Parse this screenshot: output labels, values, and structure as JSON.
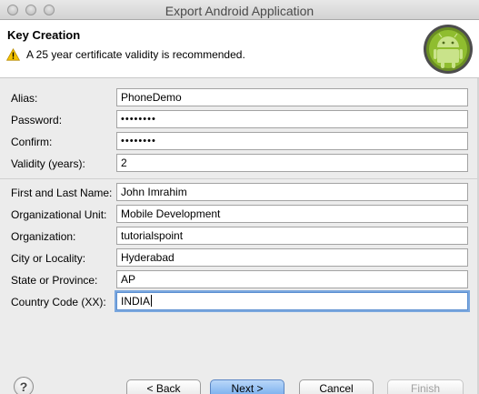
{
  "window": {
    "title": "Export Android Application"
  },
  "header": {
    "title": "Key Creation",
    "message": "A 25 year certificate validity is recommended."
  },
  "form": {
    "alias": {
      "label": "Alias:",
      "value": "PhoneDemo"
    },
    "password": {
      "label": "Password:",
      "value": "••••••••"
    },
    "confirm": {
      "label": "Confirm:",
      "value": "••••••••"
    },
    "validity": {
      "label": "Validity (years):",
      "value": "2"
    },
    "name": {
      "label": "First and Last Name:",
      "value": "John Imrahim"
    },
    "org_unit": {
      "label": "Organizational Unit:",
      "value": "Mobile Development"
    },
    "organization": {
      "label": "Organization:",
      "value": "tutorialspoint"
    },
    "city": {
      "label": "City or Locality:",
      "value": "Hyderabad"
    },
    "state": {
      "label": "State or Province:",
      "value": "AP"
    },
    "country": {
      "label": "Country Code (XX):",
      "value": "INDIA"
    }
  },
  "buttons": {
    "help": "?",
    "back": "< Back",
    "next": "Next >",
    "cancel": "Cancel",
    "finish": "Finish"
  },
  "icons": {
    "warning": "warning-icon",
    "android": "android-logo-icon",
    "help": "help-icon"
  },
  "colors": {
    "android_green": "#9bc13b",
    "primary_button": "#6ea8ec",
    "focus_ring": "#7aa7de"
  }
}
